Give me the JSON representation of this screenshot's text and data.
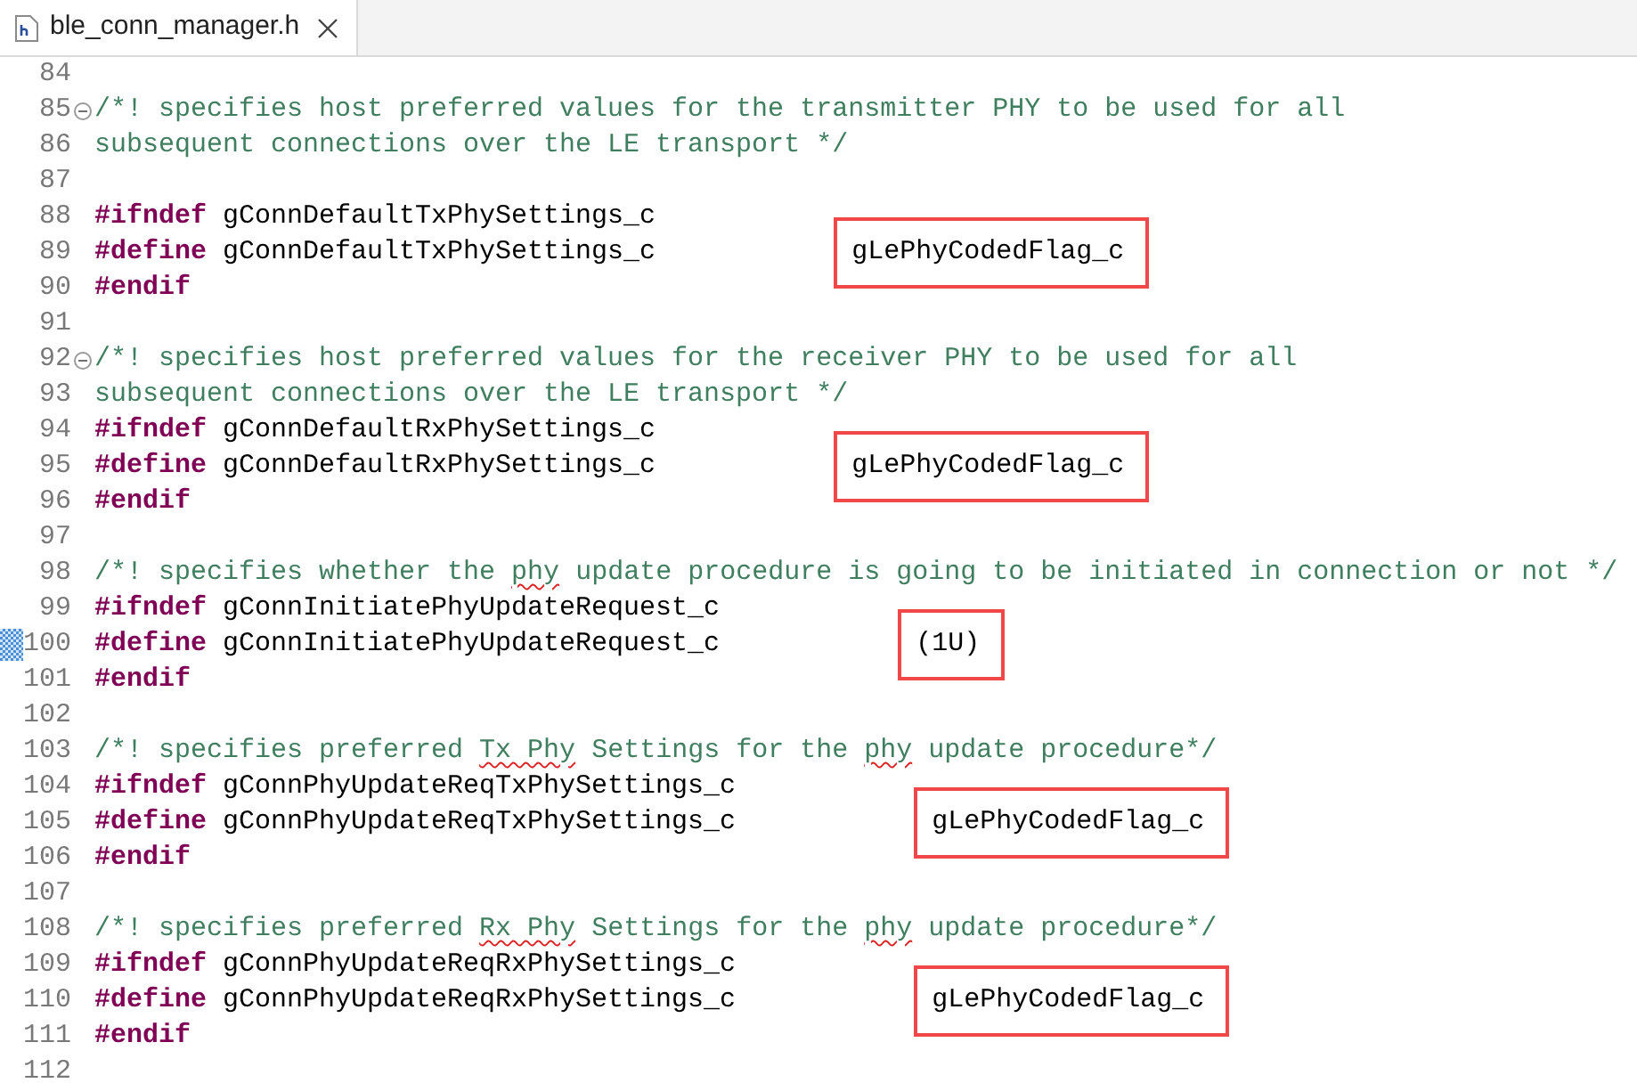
{
  "tab": {
    "title": "ble_conn_manager.h",
    "selected": true
  },
  "lines": [
    {
      "number": "84",
      "kind": "blank"
    },
    {
      "number": "85",
      "kind": "comment",
      "folded": false,
      "segments": [
        {
          "text": "/*! specifies host preferred values for the transmitter PHY to be used for all",
          "flagged": false
        }
      ]
    },
    {
      "number": "86",
      "kind": "comment",
      "segments": [
        {
          "text": "subsequent connections over the LE transport */",
          "flagged": false
        }
      ]
    },
    {
      "number": "87",
      "kind": "blank"
    },
    {
      "number": "88",
      "kind": "directive",
      "keyword": "#ifndef",
      "name": "gConnDefaultTxPhySettings_c"
    },
    {
      "number": "89",
      "kind": "directive",
      "keyword": "#define",
      "name": "gConnDefaultTxPhySettings_c",
      "value": "gLePhyCodedFlag_c",
      "highlighted": true
    },
    {
      "number": "90",
      "kind": "directive",
      "keyword": "#endif"
    },
    {
      "number": "91",
      "kind": "blank"
    },
    {
      "number": "92",
      "kind": "comment",
      "folded": false,
      "segments": [
        {
          "text": "/*! specifies host preferred values for the receiver PHY to be used for all",
          "flagged": false
        }
      ]
    },
    {
      "number": "93",
      "kind": "comment",
      "segments": [
        {
          "text": "subsequent connections over the LE transport */",
          "flagged": false
        }
      ]
    },
    {
      "number": "94",
      "kind": "directive",
      "keyword": "#ifndef",
      "name": "gConnDefaultRxPhySettings_c"
    },
    {
      "number": "95",
      "kind": "directive",
      "keyword": "#define",
      "name": "gConnDefaultRxPhySettings_c",
      "value": "gLePhyCodedFlag_c",
      "highlighted": true
    },
    {
      "number": "96",
      "kind": "directive",
      "keyword": "#endif"
    },
    {
      "number": "97",
      "kind": "blank"
    },
    {
      "number": "98",
      "kind": "comment",
      "segments": [
        {
          "text": "/*! specifies whether the ",
          "flagged": false
        },
        {
          "text": "phy",
          "flagged": true
        },
        {
          "text": " update procedure is going to be initiated in connection or not */",
          "flagged": false
        }
      ]
    },
    {
      "number": "99",
      "kind": "directive",
      "keyword": "#ifndef",
      "name": "gConnInitiatePhyUpdateRequest_c"
    },
    {
      "number": "100",
      "kind": "directive",
      "keyword": "#define",
      "name": "gConnInitiatePhyUpdateRequest_c",
      "value": "(1U)",
      "highlighted": true,
      "changed": true
    },
    {
      "number": "101",
      "kind": "directive",
      "keyword": "#endif"
    },
    {
      "number": "102",
      "kind": "blank"
    },
    {
      "number": "103",
      "kind": "comment",
      "segments": [
        {
          "text": "/*! specifies preferred ",
          "flagged": false
        },
        {
          "text": "Tx Phy",
          "flagged": true
        },
        {
          "text": " Settings for the ",
          "flagged": false
        },
        {
          "text": "phy",
          "flagged": true
        },
        {
          "text": " update procedure*/",
          "flagged": false
        }
      ]
    },
    {
      "number": "104",
      "kind": "directive",
      "keyword": "#ifndef",
      "name": "gConnPhyUpdateReqTxPhySettings_c"
    },
    {
      "number": "105",
      "kind": "directive",
      "keyword": "#define",
      "name": "gConnPhyUpdateReqTxPhySettings_c",
      "value": "gLePhyCodedFlag_c",
      "highlighted": true
    },
    {
      "number": "106",
      "kind": "directive",
      "keyword": "#endif"
    },
    {
      "number": "107",
      "kind": "blank"
    },
    {
      "number": "108",
      "kind": "comment",
      "segments": [
        {
          "text": "/*! specifies preferred ",
          "flagged": false
        },
        {
          "text": "Rx Phy",
          "flagged": true
        },
        {
          "text": " Settings for the ",
          "flagged": false
        },
        {
          "text": "phy",
          "flagged": true
        },
        {
          "text": " update procedure*/",
          "flagged": false
        }
      ]
    },
    {
      "number": "109",
      "kind": "directive",
      "keyword": "#ifndef",
      "name": "gConnPhyUpdateReqRxPhySettings_c"
    },
    {
      "number": "110",
      "kind": "directive",
      "keyword": "#define",
      "name": "gConnPhyUpdateReqRxPhySettings_c",
      "value": "gLePhyCodedFlag_c",
      "highlighted": true
    },
    {
      "number": "111",
      "kind": "directive",
      "keyword": "#endif"
    },
    {
      "number": "112",
      "kind": "blank"
    }
  ]
}
